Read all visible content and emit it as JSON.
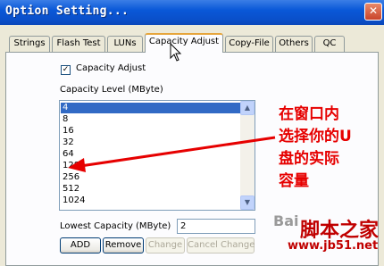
{
  "window": {
    "title": "Option Setting...",
    "close_symbol": "✕"
  },
  "tabs": [
    {
      "label": "Strings"
    },
    {
      "label": "Flash Test"
    },
    {
      "label": "LUNs"
    },
    {
      "label": "Capacity Adjust"
    },
    {
      "label": "Copy-File"
    },
    {
      "label": "Others"
    },
    {
      "label": "QC"
    }
  ],
  "active_tab": "Capacity Adjust",
  "capacity": {
    "checkbox_label": "Capacity Adjust",
    "checkbox_checked": true,
    "check_mark": "✓",
    "level_label": "Capacity Level (MByte)",
    "levels": [
      "4",
      "8",
      "16",
      "32",
      "64",
      "128",
      "256",
      "512",
      "1024"
    ],
    "selected_level": "4",
    "scroll_up": "▲",
    "scroll_down": "▼"
  },
  "lowest": {
    "label": "Lowest Capacity (MByte)",
    "value": "2"
  },
  "buttons": {
    "add": "ADD",
    "remove": "Remove",
    "change": "Change",
    "cancel_change": "Cancel Change"
  },
  "annotation": {
    "lines": [
      "在窗口内",
      "选择你的U",
      "盘的实际",
      "容量"
    ],
    "color": "#e60000"
  },
  "watermarks": {
    "baidu": "Bai",
    "site_name": "脚本之家",
    "site_url": "www.jb51.net"
  },
  "colors": {
    "titlebar": "#0a58d8",
    "selection": "#316ac5",
    "annotation": "#e60000"
  }
}
